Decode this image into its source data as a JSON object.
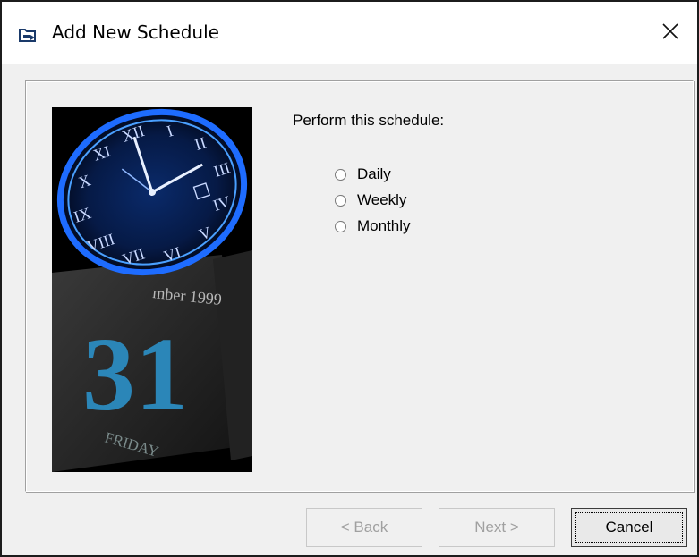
{
  "window": {
    "title": "Add New Schedule",
    "title_icon": "schedule-folder-icon",
    "close_icon": "close-icon"
  },
  "image": {
    "description_icon": "clock-calendar-image",
    "calendar_month": "mber 1999",
    "calendar_day": "31",
    "calendar_weekday": "FRIDAY"
  },
  "content": {
    "prompt": "Perform this schedule:",
    "options": [
      {
        "label": "Daily",
        "selected": false
      },
      {
        "label": "Weekly",
        "selected": false
      },
      {
        "label": "Monthly",
        "selected": false
      }
    ]
  },
  "buttons": {
    "back": "< Back",
    "next": "Next >",
    "cancel": "Cancel"
  },
  "colors": {
    "dialog_bg": "#f0f0f0",
    "clock_blue": "#1e6cff"
  }
}
